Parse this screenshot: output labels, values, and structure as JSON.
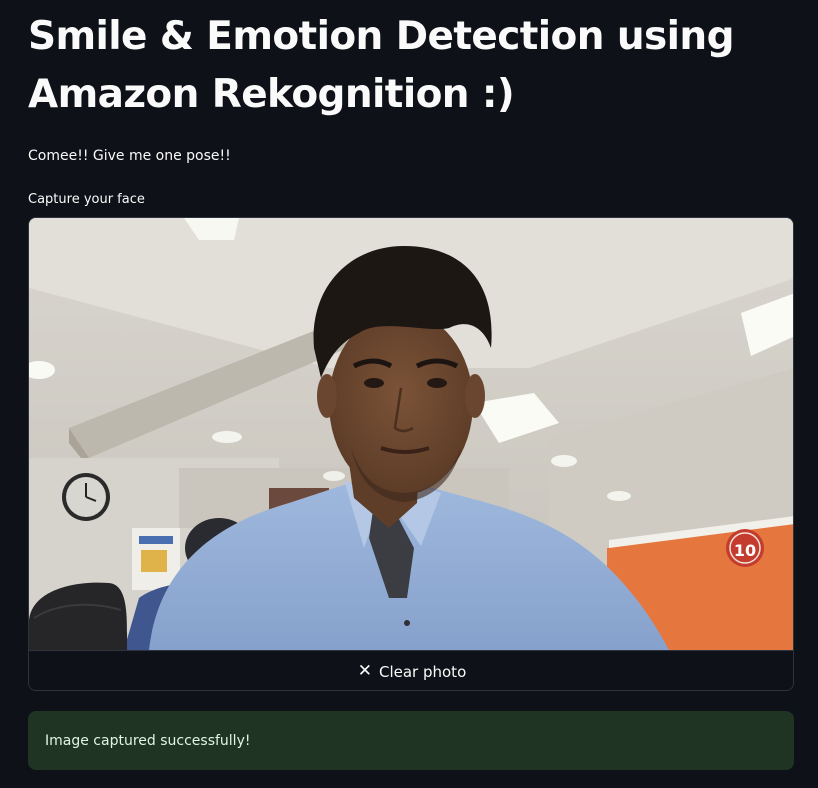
{
  "page": {
    "title": "Smile & Emotion Detection using Amazon Rekognition :)",
    "subtitle": "Comee!! Give me one pose!!"
  },
  "camera_input": {
    "label": "Capture your face",
    "clear_button_label": "Clear photo",
    "clear_icon": "close-icon",
    "photo_sign_text": "10"
  },
  "status": {
    "message": "Image captured successfully!",
    "type": "success"
  },
  "colors": {
    "background": "#0e1117",
    "text": "#fafafa",
    "success_bg": "#203424",
    "success_text": "#dff5e1",
    "border": "#2f333d"
  }
}
